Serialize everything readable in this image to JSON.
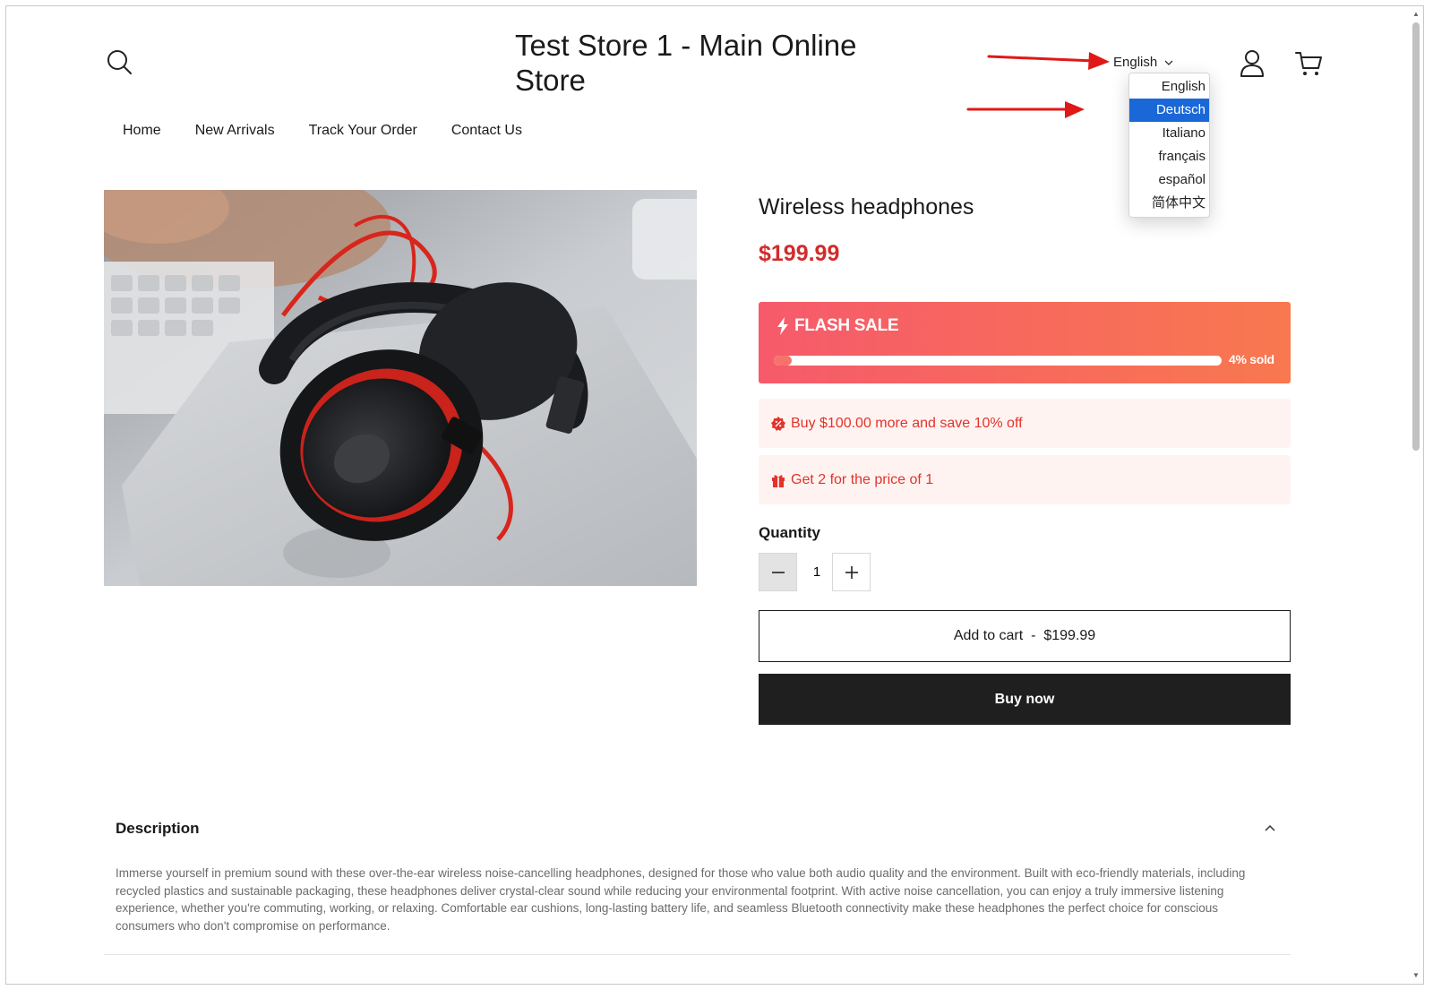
{
  "header": {
    "store_title": "Test Store 1 - Main Online Store",
    "language": {
      "current": "English",
      "options": [
        "English",
        "Deutsch",
        "Italiano",
        "français",
        "español",
        "简体中文"
      ],
      "highlighted": "Deutsch"
    }
  },
  "nav": {
    "items": [
      {
        "label": "Home"
      },
      {
        "label": "New Arrivals"
      },
      {
        "label": "Track Your Order"
      },
      {
        "label": "Contact Us"
      }
    ]
  },
  "product": {
    "title": "Wireless headphones",
    "price": "$199.99",
    "flash_sale": {
      "label": "FLASH SALE",
      "sold_text": "4% sold",
      "sold_fraction": 0.04
    },
    "promos": [
      {
        "icon": "discount-badge-icon",
        "text": "Buy $100.00 more and save 10% off"
      },
      {
        "icon": "gift-icon",
        "text": "Get 2 for the price of 1"
      }
    ],
    "quantity": {
      "label": "Quantity",
      "value": "1"
    },
    "add_to_cart": "Add to cart  -  $199.99",
    "buy_now": "Buy now"
  },
  "description": {
    "heading": "Description",
    "body": "Immerse yourself in premium sound with these over-the-ear wireless noise-cancelling headphones, designed for those who value both audio quality and the environment. Built with eco-friendly materials, including recycled plastics and sustainable packaging, these headphones deliver crystal-clear sound while reducing your environmental footprint. With active noise cancellation, you can enjoy a truly immersive listening experience, whether you're commuting, working, or relaxing. Comfortable ear cushions, long-lasting battery life, and seamless Bluetooth connectivity make these headphones the perfect choice for conscious consumers who don't compromise on performance."
  },
  "colors": {
    "price_red": "#d22b2b",
    "flash_start": "#f65a6b",
    "flash_end": "#f8784f",
    "promo_bg": "#fff3f1",
    "dropdown_highlight": "#1a68d8",
    "annotation_arrow": "#e01818",
    "buy_now_bg": "#1f1f1f"
  }
}
